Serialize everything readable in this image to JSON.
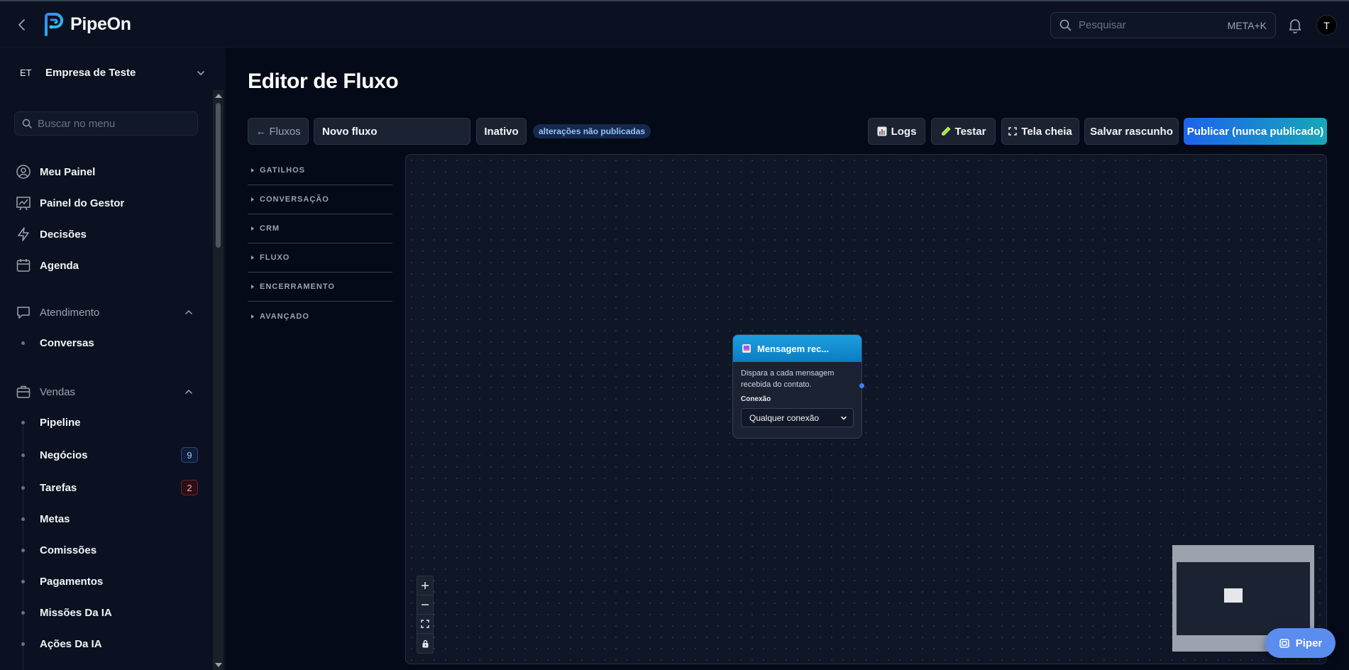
{
  "app": {
    "name": "PipeOn"
  },
  "header": {
    "search_placeholder": "Pesquisar",
    "search_shortcut": "META+K",
    "avatar_initial": "T"
  },
  "sidebar": {
    "company_abbr": "ET",
    "company_name": "Empresa de Teste",
    "search_placeholder": "Buscar no menu",
    "items": [
      {
        "label": "Meu Painel",
        "icon": "user-circle-icon"
      },
      {
        "label": "Painel do Gestor",
        "icon": "chart-icon"
      },
      {
        "label": "Decisões",
        "icon": "lightning-icon"
      },
      {
        "label": "Agenda",
        "icon": "calendar-icon"
      }
    ],
    "sections": [
      {
        "label": "Atendimento",
        "icon": "chat-icon",
        "expanded": true,
        "children": [
          {
            "label": "Conversas"
          }
        ]
      },
      {
        "label": "Vendas",
        "icon": "briefcase-icon",
        "expanded": true,
        "children": [
          {
            "label": "Pipeline"
          },
          {
            "label": "Negócios",
            "badge": "9",
            "badge_color": "blue"
          },
          {
            "label": "Tarefas",
            "badge": "2",
            "badge_color": "red"
          },
          {
            "label": "Metas"
          },
          {
            "label": "Comissões"
          },
          {
            "label": "Pagamentos"
          },
          {
            "label": "Missões Da IA"
          },
          {
            "label": "Ações Da IA"
          }
        ]
      }
    ]
  },
  "page": {
    "title": "Editor de Fluxo",
    "toolbar": {
      "back_label": "← Fluxos",
      "flow_name": "Novo fluxo",
      "status_label": "Inativo",
      "unpublished_badge": "alterações não publicadas",
      "logs_label": "Logs",
      "test_label": "Testar",
      "fullscreen_label": "Tela cheia",
      "save_draft_label": "Salvar rascunho",
      "publish_label": "Publicar (nunca publicado)"
    },
    "palette": [
      {
        "label": "GATILHOS"
      },
      {
        "label": "CONVERSAÇÃO"
      },
      {
        "label": "CRM"
      },
      {
        "label": "FLUXO"
      },
      {
        "label": "ENCERRAMENTO"
      },
      {
        "label": "AVANÇADO"
      }
    ],
    "node": {
      "title": "Mensagem rec...",
      "description": "Dispara a cada mensagem recebida do contato.",
      "field_label": "Conexão",
      "field_value": "Qualquer conexão"
    }
  },
  "assistant": {
    "label": "Piper"
  },
  "colors": {
    "accent": "#1d63ed",
    "accent_end": "#17a7b8",
    "background": "#050a18",
    "node_header": "#1d9fe0"
  }
}
